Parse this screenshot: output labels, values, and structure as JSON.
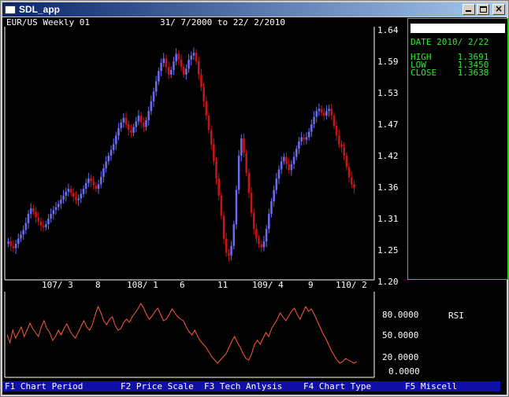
{
  "window": {
    "title": "SDL_app"
  },
  "chart": {
    "header": "EUR/US Weekly 01",
    "date_range": "31/ 7/2000 to 22/ 2/2010",
    "price_ticks": [
      "1.64",
      "1.59",
      "1.53",
      "1.47",
      "1.42",
      "1.36",
      "1.31",
      "1.25",
      "1.20"
    ],
    "date_labels": [
      "107/ 3",
      "8",
      "108/ 1",
      "6",
      "11",
      "109/ 4",
      "9",
      "110/ 2"
    ],
    "rsi_ticks": [
      "80.0000",
      "50.0000",
      "20.0000",
      "0.0000"
    ],
    "rsi_label": "RSI"
  },
  "chart_data": [
    {
      "type": "candlestick",
      "title": "EUR/US Weekly 01",
      "subtitle": "31/ 7/2000 to 22/ 2/2010",
      "ylim": [
        1.2,
        1.64
      ],
      "y_ticks": [
        1.64,
        1.59,
        1.53,
        1.47,
        1.42,
        1.36,
        1.31,
        1.25,
        1.2
      ],
      "x_tick_labels": [
        "107/ 3",
        "8",
        "108/ 1",
        "6",
        "11",
        "109/ 4",
        "9",
        "110/ 2"
      ],
      "up_color": "#6b6bf2",
      "down_color": "#c81414",
      "close": [
        1.27,
        1.262,
        1.258,
        1.266,
        1.275,
        1.282,
        1.29,
        1.302,
        1.318,
        1.328,
        1.322,
        1.312,
        1.305,
        1.298,
        1.295,
        1.3,
        1.31,
        1.318,
        1.325,
        1.33,
        1.336,
        1.343,
        1.35,
        1.357,
        1.362,
        1.355,
        1.348,
        1.342,
        1.345,
        1.353,
        1.362,
        1.372,
        1.38,
        1.375,
        1.368,
        1.362,
        1.37,
        1.383,
        1.398,
        1.41,
        1.42,
        1.43,
        1.44,
        1.455,
        1.468,
        1.478,
        1.486,
        1.475,
        1.465,
        1.46,
        1.47,
        1.48,
        1.49,
        1.478,
        1.47,
        1.482,
        1.498,
        1.515,
        1.532,
        1.55,
        1.568,
        1.582,
        1.59,
        1.575,
        1.562,
        1.57,
        1.585,
        1.598,
        1.588,
        1.575,
        1.562,
        1.572,
        1.588,
        1.595,
        1.6,
        1.585,
        1.562,
        1.54,
        1.515,
        1.49,
        1.465,
        1.44,
        1.41,
        1.38,
        1.35,
        1.315,
        1.275,
        1.25,
        1.245,
        1.262,
        1.3,
        1.36,
        1.42,
        1.45,
        1.425,
        1.39,
        1.355,
        1.32,
        1.292,
        1.275,
        1.265,
        1.26,
        1.27,
        1.292,
        1.318,
        1.34,
        1.36,
        1.38,
        1.396,
        1.41,
        1.418,
        1.405,
        1.395,
        1.405,
        1.418,
        1.432,
        1.445,
        1.452,
        1.448,
        1.452,
        1.462,
        1.475,
        1.488,
        1.498,
        1.502,
        1.495,
        1.49,
        1.498,
        1.502,
        1.49,
        1.472,
        1.455,
        1.44,
        1.435,
        1.42,
        1.4,
        1.382,
        1.37,
        1.364
      ]
    },
    {
      "type": "line",
      "title": "RSI",
      "ylim": [
        0,
        100
      ],
      "y_ticks": [
        80,
        50,
        20,
        0
      ],
      "color": "#ff5a3c",
      "values": [
        52,
        42,
        58,
        48,
        55,
        62,
        50,
        58,
        67,
        60,
        55,
        50,
        62,
        70,
        60,
        55,
        45,
        50,
        58,
        52,
        60,
        66,
        58,
        52,
        48,
        55,
        63,
        70,
        62,
        58,
        65,
        78,
        88,
        80,
        70,
        65,
        72,
        75,
        64,
        58,
        60,
        68,
        72,
        68,
        75,
        80,
        85,
        92,
        86,
        78,
        72,
        76,
        82,
        86,
        78,
        70,
        72,
        78,
        85,
        80,
        75,
        72,
        70,
        62,
        56,
        52,
        58,
        50,
        44,
        40,
        36,
        30,
        24,
        20,
        16,
        20,
        24,
        28,
        36,
        44,
        50,
        42,
        36,
        28,
        22,
        20,
        28,
        40,
        45,
        40,
        48,
        55,
        50,
        60,
        66,
        72,
        80,
        75,
        70,
        76,
        82,
        86,
        78,
        72,
        80,
        88,
        82,
        85,
        78,
        70,
        62,
        54,
        48,
        40,
        32,
        26,
        20,
        16,
        18,
        22,
        20,
        18,
        16,
        18
      ]
    }
  ],
  "info_panel": {
    "date": "DATE 2010/ 2/22",
    "high": "HIGH     1.3691",
    "low": "LOW      1.3450",
    "close": "CLOSE    1.3638"
  },
  "fkeys": [
    {
      "label": "F1 Chart Period"
    },
    {
      "label": "F2 Price Scale"
    },
    {
      "label": "F3 Tech Anlysis"
    },
    {
      "label": "F4 Chart Type"
    },
    {
      "label": "F5 Miscell"
    }
  ]
}
